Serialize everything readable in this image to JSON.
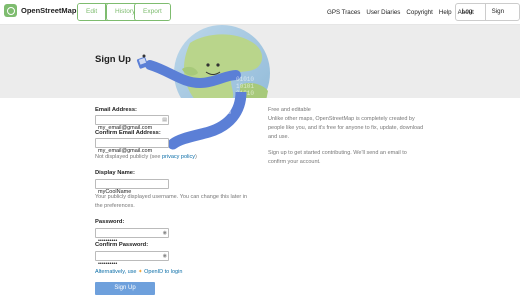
{
  "header": {
    "brand": "OpenStreetMap",
    "edit_label": "Edit",
    "caret": "▾",
    "history_label": "History",
    "export_label": "Export",
    "nav": [
      "GPS Traces",
      "User Diaries",
      "Copyright",
      "Help",
      "About"
    ],
    "login_label": "Log In",
    "signup_label": "Sign Up"
  },
  "page": {
    "title": "Sign Up"
  },
  "form": {
    "email_label": "Email Address:",
    "email_value": "my_email@gmail.com",
    "confirm_email_label": "Confirm Email Address:",
    "confirm_email_value": "my_email@gmail.com",
    "email_note_prefix": "Not displayed publicly (see ",
    "email_note_link": "privacy policy",
    "email_note_suffix": ")",
    "display_name_label": "Display Name:",
    "display_name_value": "myCoolName",
    "display_name_hint_1": "Your publicly displayed username. You can change this later in",
    "display_name_hint_2": "the preferences.",
    "password_label": "Password:",
    "password_value": "••••••••••",
    "confirm_password_label": "Confirm Password:",
    "confirm_password_value": "••••••••••",
    "openid_prefix": "Alternatively, use ",
    "openid_link": "OpenID to login",
    "submit_label": "Sign Up"
  },
  "side": {
    "heading": "Free and editable",
    "line1": "Unlike other maps, OpenStreetMap is completely created by",
    "line2": "people like you, and it's free for anyone to fix, update, download",
    "line3": "and use.",
    "line4": "Sign up to get started contributing. We'll send an email to",
    "line5": "confirm your account."
  },
  "banner_binary": [
    "01010",
    "10101",
    "01010"
  ],
  "colors": {
    "brand_green": "#7ebc6f",
    "button_blue": "#6ea0dc",
    "link_blue": "#0b6ea8",
    "banner_gray": "#ececec"
  },
  "icons": [
    "logo-icon",
    "field-key-icon",
    "openid-icon",
    "globe-illustration"
  ]
}
